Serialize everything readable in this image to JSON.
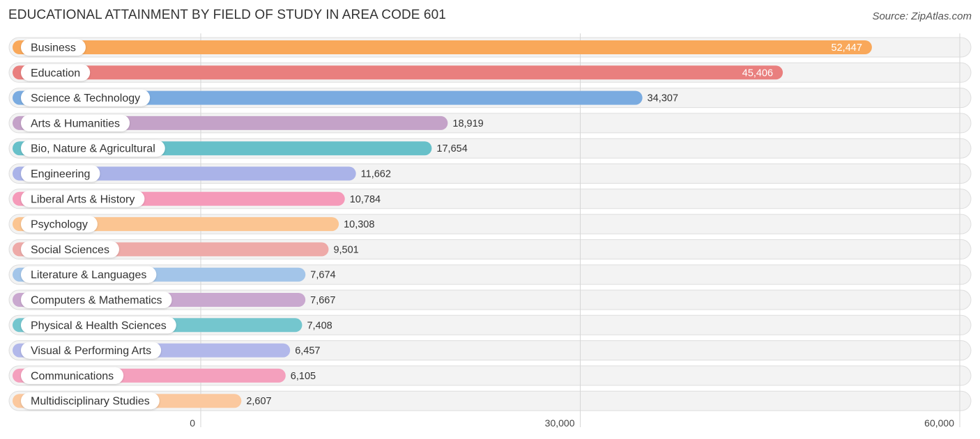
{
  "chart_data": {
    "type": "bar",
    "orientation": "horizontal",
    "title": "EDUCATIONAL ATTAINMENT BY FIELD OF STUDY IN AREA CODE 601",
    "source": "Source: ZipAtlas.com",
    "xlabel": "",
    "ylabel": "",
    "xlim": [
      0,
      60000
    ],
    "xticks": [
      0,
      30000,
      60000
    ],
    "xtick_labels": [
      "0",
      "30,000",
      "60,000"
    ],
    "grid": true,
    "categories": [
      "Business",
      "Education",
      "Science & Technology",
      "Arts & Humanities",
      "Bio, Nature & Agricultural",
      "Engineering",
      "Liberal Arts & History",
      "Psychology",
      "Social Sciences",
      "Literature & Languages",
      "Computers & Mathematics",
      "Physical & Health Sciences",
      "Visual & Performing Arts",
      "Communications",
      "Multidisciplinary Studies"
    ],
    "values": [
      52447,
      45406,
      34307,
      18919,
      17654,
      11662,
      10784,
      10308,
      9501,
      7674,
      7667,
      7408,
      6457,
      6105,
      2607
    ],
    "value_labels": [
      "52,447",
      "45,406",
      "34,307",
      "18,919",
      "17,654",
      "11,662",
      "10,784",
      "10,308",
      "9,501",
      "7,674",
      "7,667",
      "7,408",
      "6,457",
      "6,105",
      "2,607"
    ],
    "colors": [
      "#f9a85a",
      "#e97f7e",
      "#7aabe0",
      "#c4a2c8",
      "#67c0c9",
      "#aab3e8",
      "#f59ab9",
      "#fbc592",
      "#eeaaa8",
      "#a3c5e9",
      "#c9a8cf",
      "#74c6ce",
      "#b2b8ea",
      "#f4a0bd",
      "#fbc89e"
    ]
  }
}
